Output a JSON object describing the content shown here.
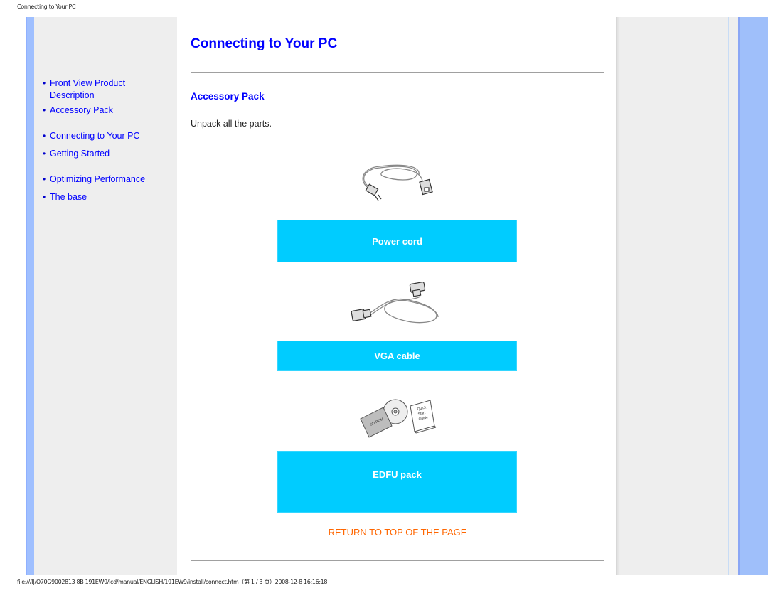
{
  "print_header": "Connecting to Your PC",
  "print_footer": "file:///I|/Q70G9002813 8B 191EW9/lcd/manual/ENGLISH/191EW9/install/connect.htm（第 1 / 3 页）2008-12-8 16:16:18",
  "sidebar": {
    "items": [
      {
        "label": "Front View Product Description"
      },
      {
        "label": "Accessory Pack"
      },
      {
        "label": "Connecting to Your PC"
      },
      {
        "label": "Getting Started"
      },
      {
        "label": "Optimizing Performance"
      },
      {
        "label": "The base"
      }
    ],
    "bullet": "•"
  },
  "main": {
    "title": "Connecting to Your PC",
    "section_heading": "Accessory Pack",
    "intro": "Unpack all the parts.",
    "items": [
      {
        "label": "Power cord",
        "image": "power-cord-illustration"
      },
      {
        "label": "VGA cable",
        "image": "vga-cable-illustration"
      },
      {
        "label": "EDFU pack",
        "image": "cd-and-quick-start-guide-illustration"
      }
    ],
    "edfu_cd_text": "CD-ROM",
    "edfu_guide_text": [
      "Quick",
      "Start",
      "Guide"
    ],
    "return_link": "RETURN TO TOP OF THE PAGE"
  },
  "colors": {
    "link": "#0000ff",
    "label_box": "#00ccff",
    "return_link": "#ff6600",
    "stripe": "#9fbfff",
    "panel": "#eeeeee"
  }
}
